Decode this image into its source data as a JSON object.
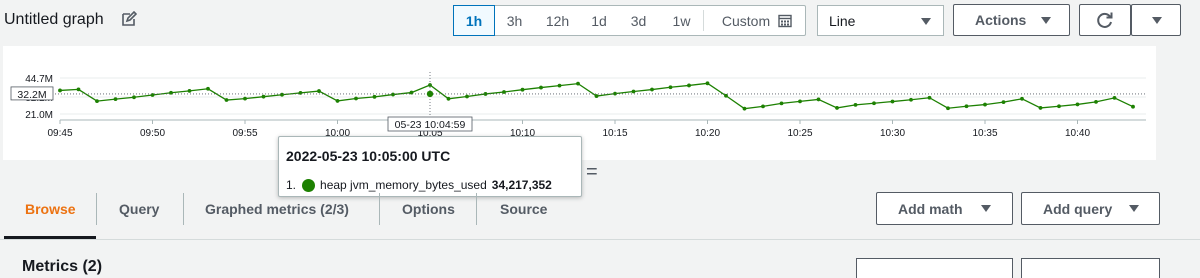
{
  "header": {
    "title": "Untitled graph",
    "ranges": [
      "1h",
      "3h",
      "12h",
      "1d",
      "3d",
      "1w"
    ],
    "active_range": "1h",
    "custom_label": "Custom",
    "chart_type": "Line",
    "actions_label": "Actions"
  },
  "tabs": [
    {
      "label": "Browse",
      "active": true
    },
    {
      "label": "Query",
      "active": false
    },
    {
      "label": "Graphed metrics (2/3)",
      "active": false
    },
    {
      "label": "Options",
      "active": false
    },
    {
      "label": "Source",
      "active": false
    }
  ],
  "toolbar": {
    "add_math_label": "Add math",
    "add_query_label": "Add query"
  },
  "bottom": {
    "metrics_label": "Metrics (2)"
  },
  "tooltip": {
    "title": "2022-05-23 10:05:00 UTC",
    "index": "1.",
    "series": "heap jvm_memory_bytes_used",
    "value": "34,217,352"
  },
  "crosshair_label": "05-23 10:04:59",
  "colors": {
    "accent": "#0073bb",
    "active_tab": "#ec7211",
    "series": "#1d8102"
  },
  "chart_data": {
    "type": "line",
    "y_ticks": [
      "44.7M",
      "32.2M",
      "21.0M"
    ],
    "y_tick_values": [
      44.7,
      32.2,
      21.0
    ],
    "hover_y_label": "32.2M",
    "x_ticks": [
      "09:45",
      "09:50",
      "09:55",
      "10:00",
      "10:05",
      "10:10",
      "10:15",
      "10:20",
      "10:25",
      "10:30",
      "10:35",
      "10:40"
    ],
    "ylim": [
      21.0,
      44.7
    ],
    "series": [
      {
        "name": "heap jvm_memory_bytes_used",
        "x_minutes": [
          0,
          1,
          2,
          3,
          4,
          5,
          6,
          7,
          8,
          9,
          10,
          11,
          12,
          13,
          14,
          15,
          16,
          17,
          18,
          19,
          20,
          21,
          22,
          23,
          24,
          25,
          26,
          27,
          28,
          29,
          30,
          31,
          32,
          33,
          34,
          35,
          36,
          37,
          38,
          39,
          40,
          41,
          42,
          43,
          44,
          45,
          46,
          47,
          48,
          49,
          50,
          51,
          52,
          53,
          54,
          55,
          56,
          57,
          58
        ],
        "values": [
          36.5,
          37.2,
          29.5,
          30.8,
          32.0,
          33.5,
          35.0,
          36.2,
          37.6,
          30.2,
          31.1,
          32.4,
          33.7,
          34.9,
          36.1,
          29.6,
          31.2,
          32.3,
          33.8,
          35.1,
          40.1,
          31.0,
          32.5,
          34.2,
          35.5,
          37.0,
          38.4,
          39.7,
          41.0,
          32.8,
          34.4,
          35.8,
          37.1,
          38.6,
          39.8,
          41.2,
          33.0,
          24.5,
          26.0,
          28.0,
          29.3,
          30.6,
          25.0,
          27.0,
          28.1,
          29.2,
          30.4,
          31.7,
          24.8,
          26.1,
          27.2,
          28.8,
          31.0,
          25.0,
          26.1,
          27.3,
          29.0,
          31.6,
          25.8
        ]
      }
    ],
    "hover_point": {
      "x_minutes": 20,
      "value": 34.217352
    },
    "grid": true
  }
}
